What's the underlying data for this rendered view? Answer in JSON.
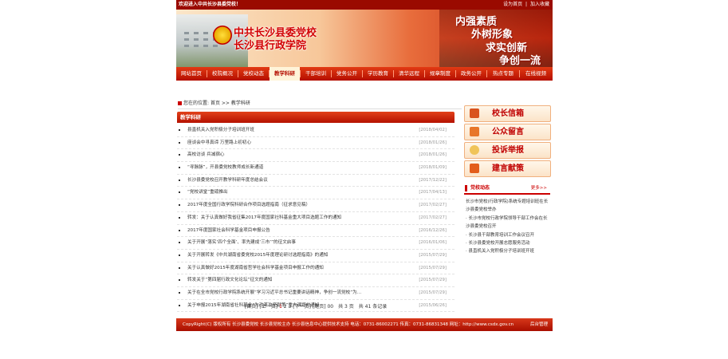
{
  "topbar": {
    "welcome": "欢迎进入中共长沙县委党校！",
    "links": [
      "设为首页",
      "|",
      "加入收藏"
    ]
  },
  "banner": {
    "school_line1": "中共长沙县委党校",
    "school_line2": "长沙县行政学院",
    "slogans": [
      "内强素质",
      "外树形象",
      "求实创新",
      "争创一流"
    ]
  },
  "nav": {
    "items": [
      "网站首页",
      "校院概况",
      "党校动态",
      "教学科研",
      "干部培训",
      "党务公开",
      "学历教育",
      "清华远程",
      "规章制度",
      "政务公开",
      "热点专题",
      "在线视频"
    ],
    "active_index": 3
  },
  "breadcrumb": {
    "prefix": "您在的位置:",
    "home": "首页",
    "sep": ">>",
    "current": "教学科研"
  },
  "main": {
    "heading": "教学科研",
    "rows": [
      {
        "title": "县直机关入党积极分子培训班开班",
        "date": "[2018/04/02]"
      },
      {
        "title": "座谈会中寻真谛 万里路上初初心",
        "date": "[2018/01/26]"
      },
      {
        "title": "高校访谈 兵减宿心",
        "date": "[2018/01/26]"
      },
      {
        "title": "“寻脉脉”，开县委党校教师成长新通道",
        "date": "[2018/01/09]"
      },
      {
        "title": "长沙县委党校召开教学科研年度总结会议",
        "date": "[2017/12/22]"
      },
      {
        "title": "“党校讲堂”重磅推出",
        "date": "[2017/04/13]"
      },
      {
        "title": "2017年度全国行政学院科研合作项目选题指南（征求意见稿）",
        "date": "[2017/02/27]"
      },
      {
        "title": "转发：关于认真做好我省征集2017年度国家社科基金重大项目选题工作的通知",
        "date": "[2017/02/27]"
      },
      {
        "title": "2017年度国家社会科学基金项目申报公告",
        "date": "[2016/12/26]"
      },
      {
        "title": "关于开展“落实‘四个全面’、率先建成‘三市’”的征文启事",
        "date": "[2016/01/06]"
      },
      {
        "title": "关于开展转发《中共湖南省委党校2015年度理论研讨选题指南》的通知",
        "date": "[2015/07/29]"
      },
      {
        "title": "关于认真做好2015年度湖南省哲学社会科学基金项目申报工作的通知",
        "date": "[2015/07/29]"
      },
      {
        "title": "转发关于“第四届行政文化论坛”征文的通知",
        "date": "[2015/07/29]"
      },
      {
        "title": "关于在全市党校行政学院系统开展“学习习近平总书记重要讲话精神，争创一流党校”为...",
        "date": "[2015/07/29]"
      },
      {
        "title": "关于申报2015年湖南省社科基金“为改革攻坚献策”重大课题的通知",
        "date": "[2015/06/26]"
      }
    ]
  },
  "pager": {
    "first": "[首页]",
    "prev": "[上一页]",
    "pages": [
      "1",
      "2",
      "3"
    ],
    "current_page": "1",
    "next": "[下一页]",
    "last": "[尾页]",
    "summary": "00　共 3 页　共 41 条记录"
  },
  "sidebar": {
    "buttons": [
      {
        "label": "校长信箱",
        "color": "#d9531e"
      },
      {
        "label": "公众留言",
        "color": "#e8762a"
      },
      {
        "label": "投诉举报",
        "color": "#f0c45a"
      },
      {
        "label": "建言献策",
        "color": "#e35d1c"
      }
    ],
    "news_title": "党校动态",
    "news_more": "更多>>",
    "news": [
      "长沙市党校(行政学院)系统专题培训班在长沙县委党校举办",
      "· 长沙市党校行政学院领导干部工作会在长沙县委党校召开",
      "· 长沙县干部教育培训工作会议召开",
      "· 长沙县委党校开展志愿服务活动",
      "· 县直机关入党积极分子培训班开班"
    ]
  },
  "footer": {
    "text": "CopyRight(C)  版权所有  长沙县委党校  长沙县党校主办  长沙县信息中心提供技术支持  电话：0731-86002271  传真：0731-86831348  网址：http://www.csdx.gov.cn",
    "right": "后台管理"
  }
}
